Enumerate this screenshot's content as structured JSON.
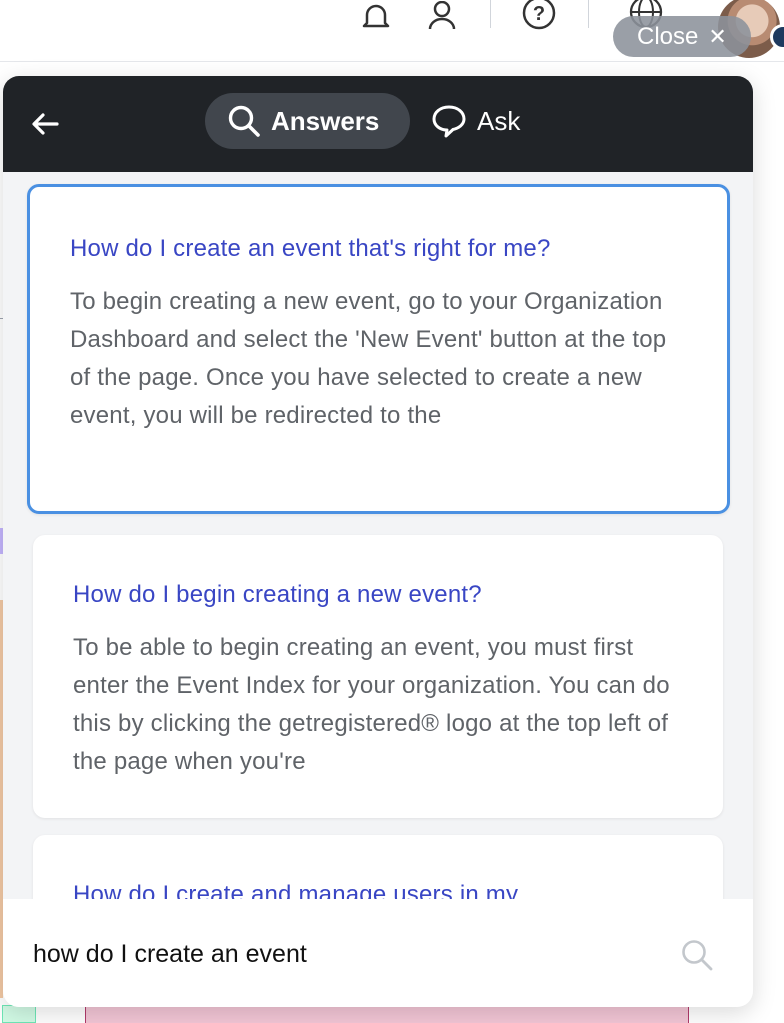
{
  "close": {
    "label": "Close",
    "icon": "close-icon"
  },
  "header": {
    "back_icon": "arrow-left-icon",
    "tabs": [
      {
        "label": "Answers",
        "icon": "search-icon",
        "active": true
      },
      {
        "label": "Ask",
        "icon": "chat-bubble-icon",
        "active": false
      }
    ]
  },
  "results": [
    {
      "title": "How do I create an event that's right for me?",
      "excerpt": "To begin creating a new event, go to your Organization Dashboard and select the 'New Event' button at the top of the page. Once you have selected to create a new event, you will be redirected to the"
    },
    {
      "title": "How do I begin creating a new event?",
      "excerpt": "To be able to begin creating an event, you must first enter the Event Index for your organization. You can do this by clicking the getregistered® logo at the top left of the page when you're"
    },
    {
      "title": "How do I create and manage users in my",
      "excerpt": ""
    }
  ],
  "search": {
    "value": "how do I create an event"
  },
  "colors": {
    "header_bg": "#202327",
    "active_tab_bg": "#41464d",
    "link_title": "#3946c4",
    "active_card_border": "#4a90e2"
  }
}
